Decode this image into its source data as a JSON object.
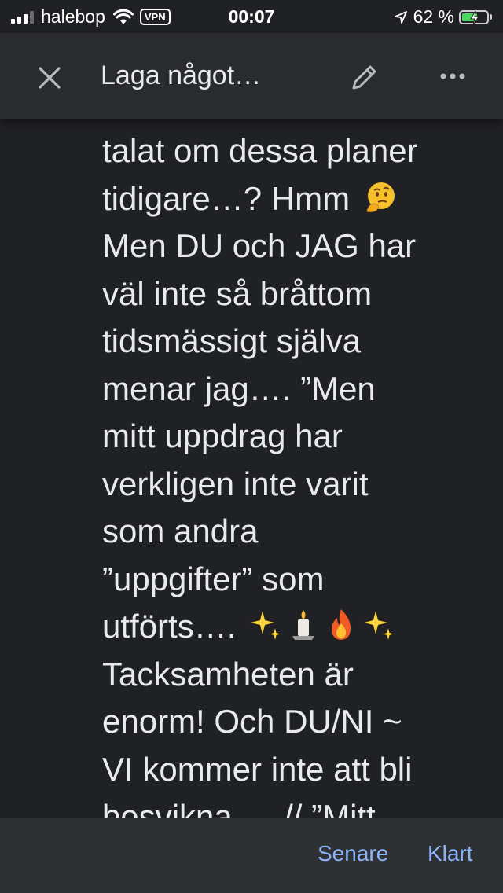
{
  "status_bar": {
    "carrier": "halebop",
    "vpn": "VPN",
    "time": "00:07",
    "battery_percent": "62 %",
    "battery_level": 0.62
  },
  "toolbar": {
    "title": "Laga något…",
    "icons": [
      "close-icon",
      "edit-pencil-icon",
      "more-options-icon"
    ]
  },
  "note": {
    "lines": [
      "talat om dessa planer",
      "tidigare…? Hmm",
      "Men DU och JAG har",
      "väl inte så bråttom",
      "tidsmässigt själva",
      "menar jag…. ”Men",
      "mitt uppdrag har",
      "verkligen inte varit",
      "som andra",
      "”uppgifter” som",
      "utförts….",
      "Tacksamheten är",
      "enorm! Och DU/NI ~",
      "VI kommer inte att bli",
      "besvikna…. // ”Mitt"
    ],
    "emoji": {
      "line_2": [
        "thinking-face-emoji"
      ],
      "line_11": [
        "sparkles-emoji",
        "candle-emoji",
        "fire-emoji",
        "sparkles-emoji"
      ]
    }
  },
  "bottom_bar": {
    "later_label": "Senare",
    "done_label": "Klart"
  },
  "colors": {
    "background": "#202124",
    "toolbar": "#2a2b2e",
    "bottom_bar": "#2f3033",
    "accent": "#8ab4f8",
    "text": "#e8eaed"
  }
}
